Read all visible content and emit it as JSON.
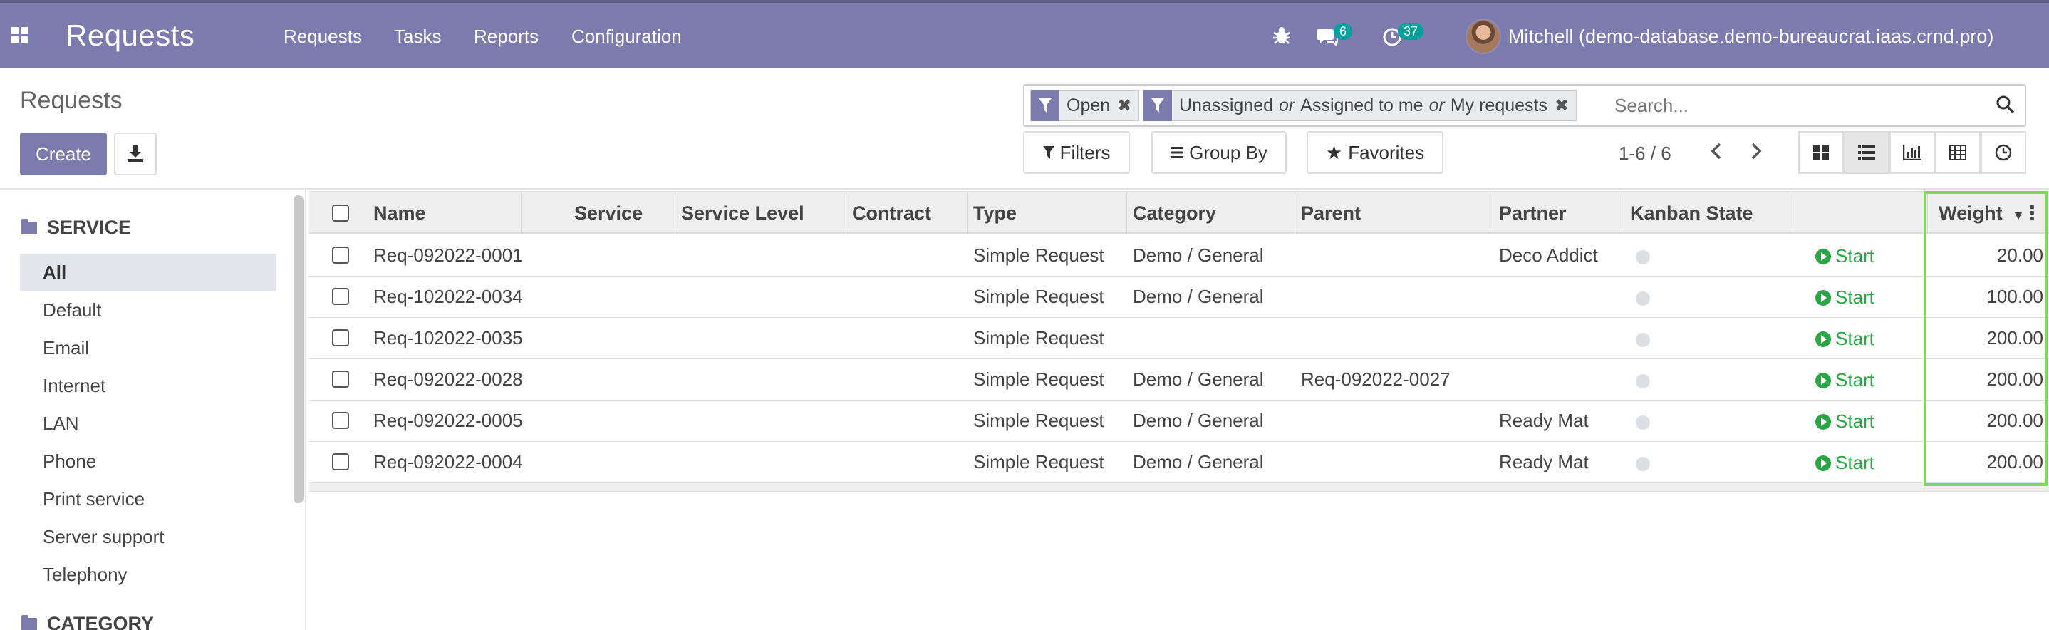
{
  "navbar": {
    "brand": "Requests",
    "menu": [
      "Requests",
      "Tasks",
      "Reports",
      "Configuration"
    ],
    "messages_count": "6",
    "activities_count": "37",
    "user": "Mitchell (demo-database.demo-bureaucrat.iaas.crnd.pro)"
  },
  "control_panel": {
    "breadcrumb": "Requests",
    "create_label": "Create",
    "facets": [
      {
        "label": "Open"
      },
      {
        "parts": [
          "Unassigned",
          "or",
          "Assigned to me",
          "or",
          "My requests"
        ]
      }
    ],
    "search_placeholder": "Search...",
    "filters_label": "Filters",
    "groupby_label": "Group By",
    "favorites_label": "Favorites",
    "pager": "1-6 / 6"
  },
  "sidebar": {
    "service_header": "SERVICE",
    "items": [
      "All",
      "Default",
      "Email",
      "Internet",
      "LAN",
      "Phone",
      "Print service",
      "Server support",
      "Telephony"
    ],
    "category_header": "CATEGORY"
  },
  "table": {
    "columns": [
      "Name",
      "Service",
      "Service Level",
      "Contract",
      "Type",
      "Category",
      "Parent",
      "Partner",
      "Kanban State",
      "",
      "Weight"
    ],
    "start_label": "Start",
    "rows": [
      {
        "name": "Req-092022-0001",
        "type": "Simple Request",
        "category": "Demo / General",
        "parent": "",
        "partner": "Deco Addict",
        "weight": "20.00"
      },
      {
        "name": "Req-102022-0034",
        "type": "Simple Request",
        "category": "Demo / General",
        "parent": "",
        "partner": "",
        "weight": "100.00"
      },
      {
        "name": "Req-102022-0035",
        "type": "Simple Request",
        "category": "",
        "parent": "",
        "partner": "",
        "weight": "200.00"
      },
      {
        "name": "Req-092022-0028",
        "type": "Simple Request",
        "category": "Demo / General",
        "parent": "Req-092022-0027",
        "partner": "",
        "weight": "200.00"
      },
      {
        "name": "Req-092022-0005",
        "type": "Simple Request",
        "category": "Demo / General",
        "parent": "",
        "partner": "Ready Mat",
        "weight": "200.00"
      },
      {
        "name": "Req-092022-0004",
        "type": "Simple Request",
        "category": "Demo / General",
        "parent": "",
        "partner": "Ready Mat",
        "weight": "200.00"
      }
    ]
  },
  "colors": {
    "brand": "#7c7bad",
    "start": "#28a745",
    "highlight": "#7ed957",
    "badge": "#00a09d"
  },
  "icons": [
    "apps-icon",
    "bug-icon",
    "chat-icon",
    "clock-icon",
    "filter-icon",
    "close-icon",
    "search-icon",
    "download-icon",
    "caret-down-icon",
    "star-icon",
    "kanban-view-icon",
    "list-view-icon",
    "graph-view-icon",
    "pivot-view-icon",
    "activity-view-icon",
    "folder-icon",
    "play-icon",
    "column-options-icon"
  ]
}
